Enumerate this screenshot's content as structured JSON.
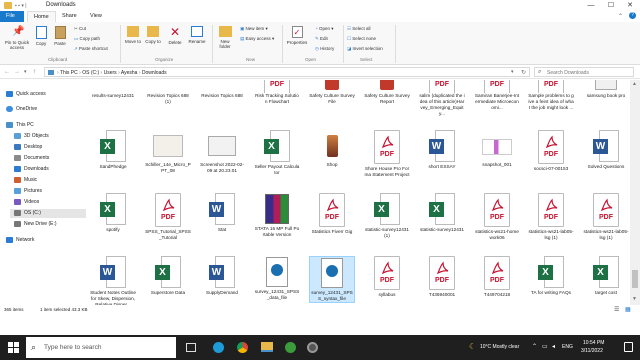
{
  "window": {
    "title": "Downloads",
    "minimize": "—",
    "maximize": "☐",
    "close": "✕"
  },
  "tabs": [
    {
      "label": "File"
    },
    {
      "label": "Home"
    },
    {
      "label": "Share"
    },
    {
      "label": "View"
    }
  ],
  "ribbon": {
    "clipboard": {
      "pin": "Pin to Quick access",
      "copy": "Copy",
      "paste": "Paste",
      "cut": "Cut",
      "copy_path": "Copy path",
      "paste_shortcut": "Paste shortcut",
      "group": "Clipboard"
    },
    "organize": {
      "move_to": "Move to",
      "copy_to": "Copy to",
      "delete": "Delete",
      "rename": "Rename",
      "group": "Organize"
    },
    "new": {
      "new_folder": "New folder",
      "new_item": "New item ▾",
      "easy_access": "Easy access ▾",
      "group": "New"
    },
    "open": {
      "properties": "Properties",
      "open": "Open ▾",
      "edit": "Edit",
      "history": "History",
      "group": "Open"
    },
    "select": {
      "select_all": "Select all",
      "select_none": "Select none",
      "invert": "Invert selection",
      "group": "Select"
    }
  },
  "address": {
    "crumbs": [
      "This PC",
      "OS (C:)",
      "Users",
      "Ayesha",
      "Downloads"
    ],
    "search_placeholder": "Search Downloads"
  },
  "nav": [
    {
      "label": "Quick access",
      "color": "#2b7cd3"
    },
    {
      "label": "OneDrive",
      "color": "#3d8de0"
    },
    {
      "label": "This PC",
      "color": "#4a90c8"
    },
    {
      "label": "3D Objects",
      "color": "#5aa0d8"
    },
    {
      "label": "Desktop",
      "color": "#3a78c0"
    },
    {
      "label": "Documents",
      "color": "#8a8a8a"
    },
    {
      "label": "Downloads",
      "color": "#2b7cd3"
    },
    {
      "label": "Music",
      "color": "#d06030"
    },
    {
      "label": "Pictures",
      "color": "#5aa0d8"
    },
    {
      "label": "Videos",
      "color": "#7a5ac0"
    },
    {
      "label": "OS (C:)",
      "color": "#777"
    },
    {
      "label": "New Drive (E:)",
      "color": "#777"
    },
    {
      "label": "Network",
      "color": "#2b7cd3"
    }
  ],
  "files_row0": [
    "results-survey12431",
    "Revision Topics 688 (1)",
    "Revision Topics 688",
    "Risk Tracking Solution Flowchart",
    "Safety Culture Survey File",
    "Safety Culture Survey Report",
    "salim (duplicated the idea of this article)Harvey_Emerging_Equity...",
    "Samiran Banerjee-Intermediate Microeconomi...",
    "Sample problems to give a feint idea of what the job might look ...",
    "samsung book pro"
  ],
  "files_row1": [
    {
      "name": "SandPhedge",
      "type": "excel"
    },
    {
      "name": "Schiller_14e_Micro_PPT_08",
      "type": "doc"
    },
    {
      "name": "Screenshot 2022-02-09 at 20.23.01",
      "type": "img"
    },
    {
      "name": "Seller Payout Calculator",
      "type": "excel"
    },
    {
      "name": "Shop",
      "type": "phone"
    },
    {
      "name": "Shore House Pro Forma Statement Project",
      "type": "pdf"
    },
    {
      "name": "short ESSAY",
      "type": "word"
    },
    {
      "name": "snapshot_001",
      "type": "img2"
    },
    {
      "name": "socsci-07-00153",
      "type": "pdf"
    },
    {
      "name": "Solved Questions",
      "type": "word"
    }
  ],
  "files_row2": [
    {
      "name": "spotify",
      "type": "excel"
    },
    {
      "name": "SPSS_Tutorial_SPSS_Tutorial",
      "type": "pdf"
    },
    {
      "name": "Stat",
      "type": "word"
    },
    {
      "name": "STATA 16 MP Full Portable Version",
      "type": "rar"
    },
    {
      "name": "Statistics Fiverr Gig",
      "type": "pdf"
    },
    {
      "name": "statistic-survey12431 (1)",
      "type": "excel"
    },
    {
      "name": "statistic-survey12431",
      "type": "excel"
    },
    {
      "name": "statistics-ws21-homework06",
      "type": "pdf"
    },
    {
      "name": "statistics-ws21-lab05-lsg (1)",
      "type": "pdf"
    },
    {
      "name": "statistics-ws21-lab05-lsg (1)",
      "type": "pdf"
    }
  ],
  "files_row3": [
    {
      "name": "Student Notes Outline for Skew, Dispersion, Relative Disper...",
      "type": "word"
    },
    {
      "name": "Superstore Data",
      "type": "excel"
    },
    {
      "name": "SupplyDemand",
      "type": "word"
    },
    {
      "name": "survey_12431_SPSS_data_file",
      "type": "spss"
    },
    {
      "name": "survey_12431_SPSS_syntax_file",
      "type": "spss"
    },
    {
      "name": "syllabus",
      "type": "pdf"
    },
    {
      "name": "T436940001",
      "type": "pdf"
    },
    {
      "name": "T449704218",
      "type": "pdf"
    },
    {
      "name": "TA for writing FAQs",
      "type": "excel"
    },
    {
      "name": "target cost",
      "type": "excel"
    }
  ],
  "status": {
    "count": "365 items",
    "selected": "1 item selected  43.3 KB"
  },
  "taskbar": {
    "search_placeholder": "Type here to search",
    "temp": "10°C Mostly clear",
    "lang": "ENG",
    "time": "10:54 PM",
    "date": "3/11/2022"
  }
}
